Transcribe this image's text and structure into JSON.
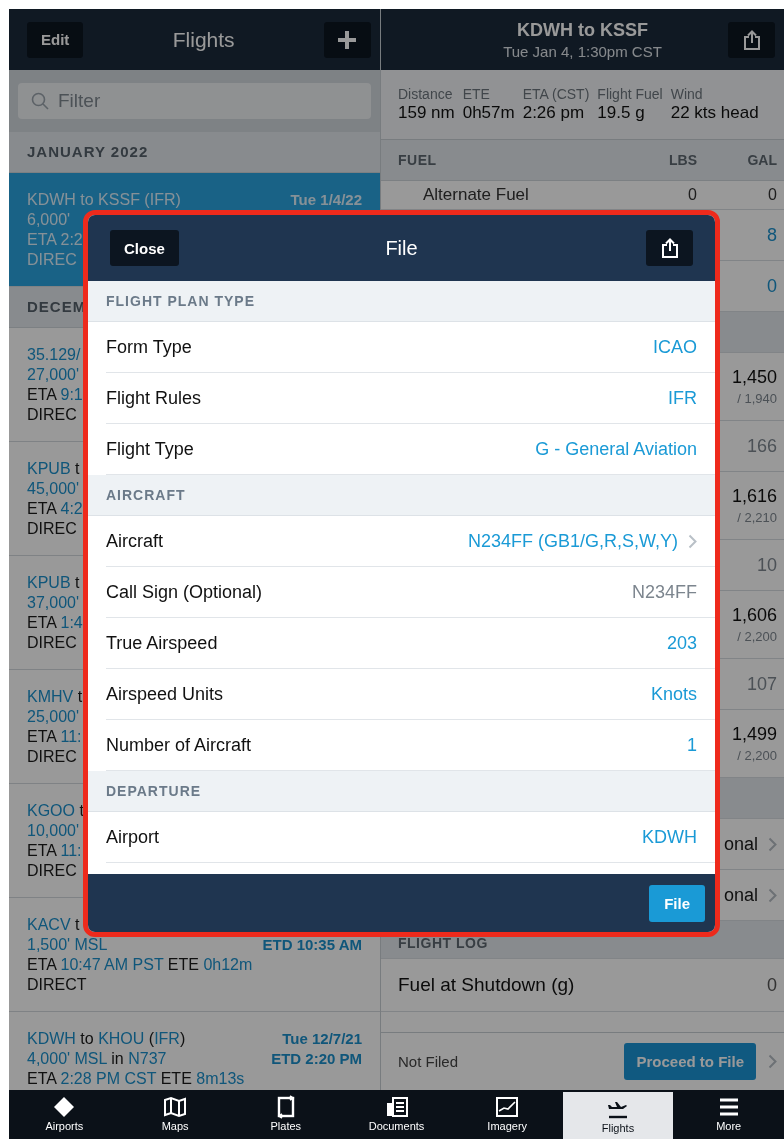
{
  "sidebar": {
    "edit_button": "Edit",
    "title": "Flights",
    "filter": {
      "placeholder": "Filter"
    },
    "sections": [
      {
        "title": "JANUARY 2022",
        "flights": [
          {
            "selected": true,
            "lines": [
              {
                "parts": [
                  {
                    "text": "KDWH to KSSF (IFR)",
                    "kind": "plain"
                  }
                ],
                "right": "Tue 1/4/22"
              },
              {
                "parts": [
                  {
                    "text": "6,000'",
                    "kind": "plain"
                  }
                ]
              },
              {
                "parts": [
                  {
                    "text": "ETA 2:2",
                    "kind": "plain"
                  }
                ]
              },
              {
                "parts": [
                  {
                    "text": "DIREC",
                    "kind": "plain"
                  }
                ]
              }
            ]
          }
        ]
      },
      {
        "title": "DECEM",
        "flights": [
          {
            "selected": false,
            "lines": [
              {
                "parts": [
                  {
                    "text": "35.129/",
                    "kind": "link"
                  }
                ]
              },
              {
                "parts": [
                  {
                    "text": "27,000'",
                    "kind": "link"
                  }
                ]
              },
              {
                "parts": [
                  {
                    "text": "ETA ",
                    "kind": "plain"
                  },
                  {
                    "text": "9:1",
                    "kind": "link"
                  }
                ]
              },
              {
                "parts": [
                  {
                    "text": "DIREC",
                    "kind": "plain"
                  }
                ]
              }
            ]
          },
          {
            "selected": false,
            "lines": [
              {
                "parts": [
                  {
                    "text": "KPUB",
                    "kind": "link"
                  },
                  {
                    "text": " t",
                    "kind": "plain"
                  }
                ]
              },
              {
                "parts": [
                  {
                    "text": "45,000'",
                    "kind": "link"
                  }
                ]
              },
              {
                "parts": [
                  {
                    "text": "ETA ",
                    "kind": "plain"
                  },
                  {
                    "text": "4:2",
                    "kind": "link"
                  }
                ]
              },
              {
                "parts": [
                  {
                    "text": "DIREC",
                    "kind": "plain"
                  }
                ]
              }
            ]
          },
          {
            "selected": false,
            "lines": [
              {
                "parts": [
                  {
                    "text": "KPUB",
                    "kind": "link"
                  },
                  {
                    "text": " t",
                    "kind": "plain"
                  }
                ]
              },
              {
                "parts": [
                  {
                    "text": "37,000'",
                    "kind": "link"
                  }
                ]
              },
              {
                "parts": [
                  {
                    "text": "ETA ",
                    "kind": "plain"
                  },
                  {
                    "text": "1:4",
                    "kind": "link"
                  }
                ]
              },
              {
                "parts": [
                  {
                    "text": "DIREC",
                    "kind": "plain"
                  }
                ]
              }
            ]
          },
          {
            "selected": false,
            "lines": [
              {
                "parts": [
                  {
                    "text": "KMHV",
                    "kind": "link"
                  },
                  {
                    "text": " t",
                    "kind": "plain"
                  }
                ]
              },
              {
                "parts": [
                  {
                    "text": "25,000'",
                    "kind": "link"
                  }
                ]
              },
              {
                "parts": [
                  {
                    "text": "ETA ",
                    "kind": "plain"
                  },
                  {
                    "text": "11:",
                    "kind": "link"
                  }
                ]
              },
              {
                "parts": [
                  {
                    "text": "DIREC",
                    "kind": "plain"
                  }
                ]
              }
            ]
          },
          {
            "selected": false,
            "lines": [
              {
                "parts": [
                  {
                    "text": "KGOO",
                    "kind": "link"
                  },
                  {
                    "text": " t",
                    "kind": "plain"
                  }
                ]
              },
              {
                "parts": [
                  {
                    "text": "10,000'",
                    "kind": "link"
                  }
                ]
              },
              {
                "parts": [
                  {
                    "text": "ETA ",
                    "kind": "plain"
                  },
                  {
                    "text": "11:",
                    "kind": "link"
                  }
                ]
              },
              {
                "parts": [
                  {
                    "text": "DIREC",
                    "kind": "plain"
                  }
                ]
              }
            ]
          },
          {
            "selected": false,
            "lines": [
              {
                "parts": [
                  {
                    "text": "KACV",
                    "kind": "link"
                  },
                  {
                    "text": " t",
                    "kind": "plain"
                  }
                ]
              },
              {
                "parts": [
                  {
                    "text": "1,500' MSL",
                    "kind": "link"
                  }
                ],
                "right": "ETD 10:35 AM"
              },
              {
                "parts": [
                  {
                    "text": "ETA ",
                    "kind": "plain"
                  },
                  {
                    "text": "10:47 AM PST",
                    "kind": "link"
                  },
                  {
                    "text": " ETE ",
                    "kind": "plain"
                  },
                  {
                    "text": "0h12m",
                    "kind": "link"
                  }
                ]
              },
              {
                "parts": [
                  {
                    "text": "DIRECT",
                    "kind": "plain"
                  }
                ]
              }
            ]
          },
          {
            "selected": false,
            "lines": [
              {
                "parts": [
                  {
                    "text": "KDWH",
                    "kind": "link"
                  },
                  {
                    "text": " to ",
                    "kind": "plain"
                  },
                  {
                    "text": "KHOU",
                    "kind": "link"
                  },
                  {
                    "text": " (",
                    "kind": "plain"
                  },
                  {
                    "text": "IFR",
                    "kind": "link"
                  },
                  {
                    "text": ")",
                    "kind": "plain"
                  }
                ],
                "right": "Tue 12/7/21"
              },
              {
                "parts": [
                  {
                    "text": "4,000' MSL",
                    "kind": "link"
                  },
                  {
                    "text": " in ",
                    "kind": "plain"
                  },
                  {
                    "text": "N737",
                    "kind": "link"
                  }
                ],
                "right": "ETD 2:20 PM"
              },
              {
                "parts": [
                  {
                    "text": "ETA ",
                    "kind": "plain"
                  },
                  {
                    "text": "2:28 PM CST",
                    "kind": "link"
                  },
                  {
                    "text": " ETE ",
                    "kind": "plain"
                  },
                  {
                    "text": "8m13s",
                    "kind": "link"
                  }
                ]
              }
            ]
          }
        ]
      }
    ]
  },
  "detail": {
    "title": "KDWH to KSSF",
    "subtitle": "Tue Jan 4, 1:30pm CST",
    "stats": [
      {
        "label": "Distance",
        "value": "159 nm"
      },
      {
        "label": "ETE",
        "value": "0h57m"
      },
      {
        "label": "ETA (CST)",
        "value": "2:26 pm"
      },
      {
        "label": "Flight Fuel",
        "value": "19.5 g"
      },
      {
        "label": "Wind",
        "value": "22 kts head"
      }
    ],
    "fuel_header": {
      "title": "FUEL",
      "columns": [
        "LBS",
        "GAL"
      ]
    },
    "rows": [
      {
        "kind": "fuel",
        "label": "Alternate Fuel",
        "lbs": "0",
        "gal": "0"
      },
      {
        "kind": "link_value",
        "value": "8"
      },
      {
        "kind": "link_value",
        "value": "0"
      },
      {
        "kind": "gap"
      },
      {
        "kind": "weight",
        "value": "1,450",
        "limit": "/ 1,940"
      },
      {
        "kind": "muted_value",
        "value": "166"
      },
      {
        "kind": "weight",
        "value": "1,616",
        "limit": "/ 2,210"
      },
      {
        "kind": "muted_value",
        "value": "10"
      },
      {
        "kind": "weight",
        "value": "1,606",
        "limit": "/ 2,200"
      },
      {
        "kind": "muted_value",
        "value": "107"
      },
      {
        "kind": "weight",
        "value": "1,499",
        "limit": "/ 2,200"
      },
      {
        "kind": "gap"
      },
      {
        "kind": "link",
        "value": "onal"
      },
      {
        "kind": "link",
        "value": "onal"
      },
      {
        "kind": "header",
        "label": "FLIGHT LOG"
      },
      {
        "kind": "field",
        "label": "Fuel at Shutdown (g)",
        "value": "0"
      }
    ],
    "filing": {
      "status": "Not Filed",
      "button": "Proceed to File"
    }
  },
  "dialog": {
    "close_button": "Close",
    "title": "File",
    "sections": [
      {
        "title": "FLIGHT PLAN TYPE",
        "rows": [
          {
            "label": "Form Type",
            "value": "ICAO",
            "kind": "link",
            "chevron": false
          },
          {
            "label": "Flight Rules",
            "value": "IFR",
            "kind": "link",
            "chevron": false
          },
          {
            "label": "Flight Type",
            "value": "G - General Aviation",
            "kind": "link",
            "chevron": false
          }
        ]
      },
      {
        "title": "AIRCRAFT",
        "rows": [
          {
            "label": "Aircraft",
            "value": "N234FF (GB1/G,R,S,W,Y)",
            "kind": "link",
            "chevron": true
          },
          {
            "label": "Call Sign (Optional)",
            "value": "N234FF",
            "kind": "muted",
            "chevron": false
          },
          {
            "label": "True Airspeed",
            "value": "203",
            "kind": "link",
            "chevron": false
          },
          {
            "label": "Airspeed Units",
            "value": "Knots",
            "kind": "link",
            "chevron": false
          },
          {
            "label": "Number of Aircraft",
            "value": "1",
            "kind": "link",
            "chevron": false
          }
        ]
      },
      {
        "title": "DEPARTURE",
        "rows": [
          {
            "label": "Airport",
            "value": "KDWH",
            "kind": "link",
            "chevron": false
          }
        ]
      }
    ],
    "submit_button": "File"
  },
  "tab_bar": [
    {
      "label": "Airports",
      "selected": false
    },
    {
      "label": "Maps",
      "selected": false
    },
    {
      "label": "Plates",
      "selected": false
    },
    {
      "label": "Documents",
      "selected": false
    },
    {
      "label": "Imagery",
      "selected": false
    },
    {
      "label": "Flights",
      "selected": true
    },
    {
      "label": "More",
      "selected": false
    }
  ]
}
